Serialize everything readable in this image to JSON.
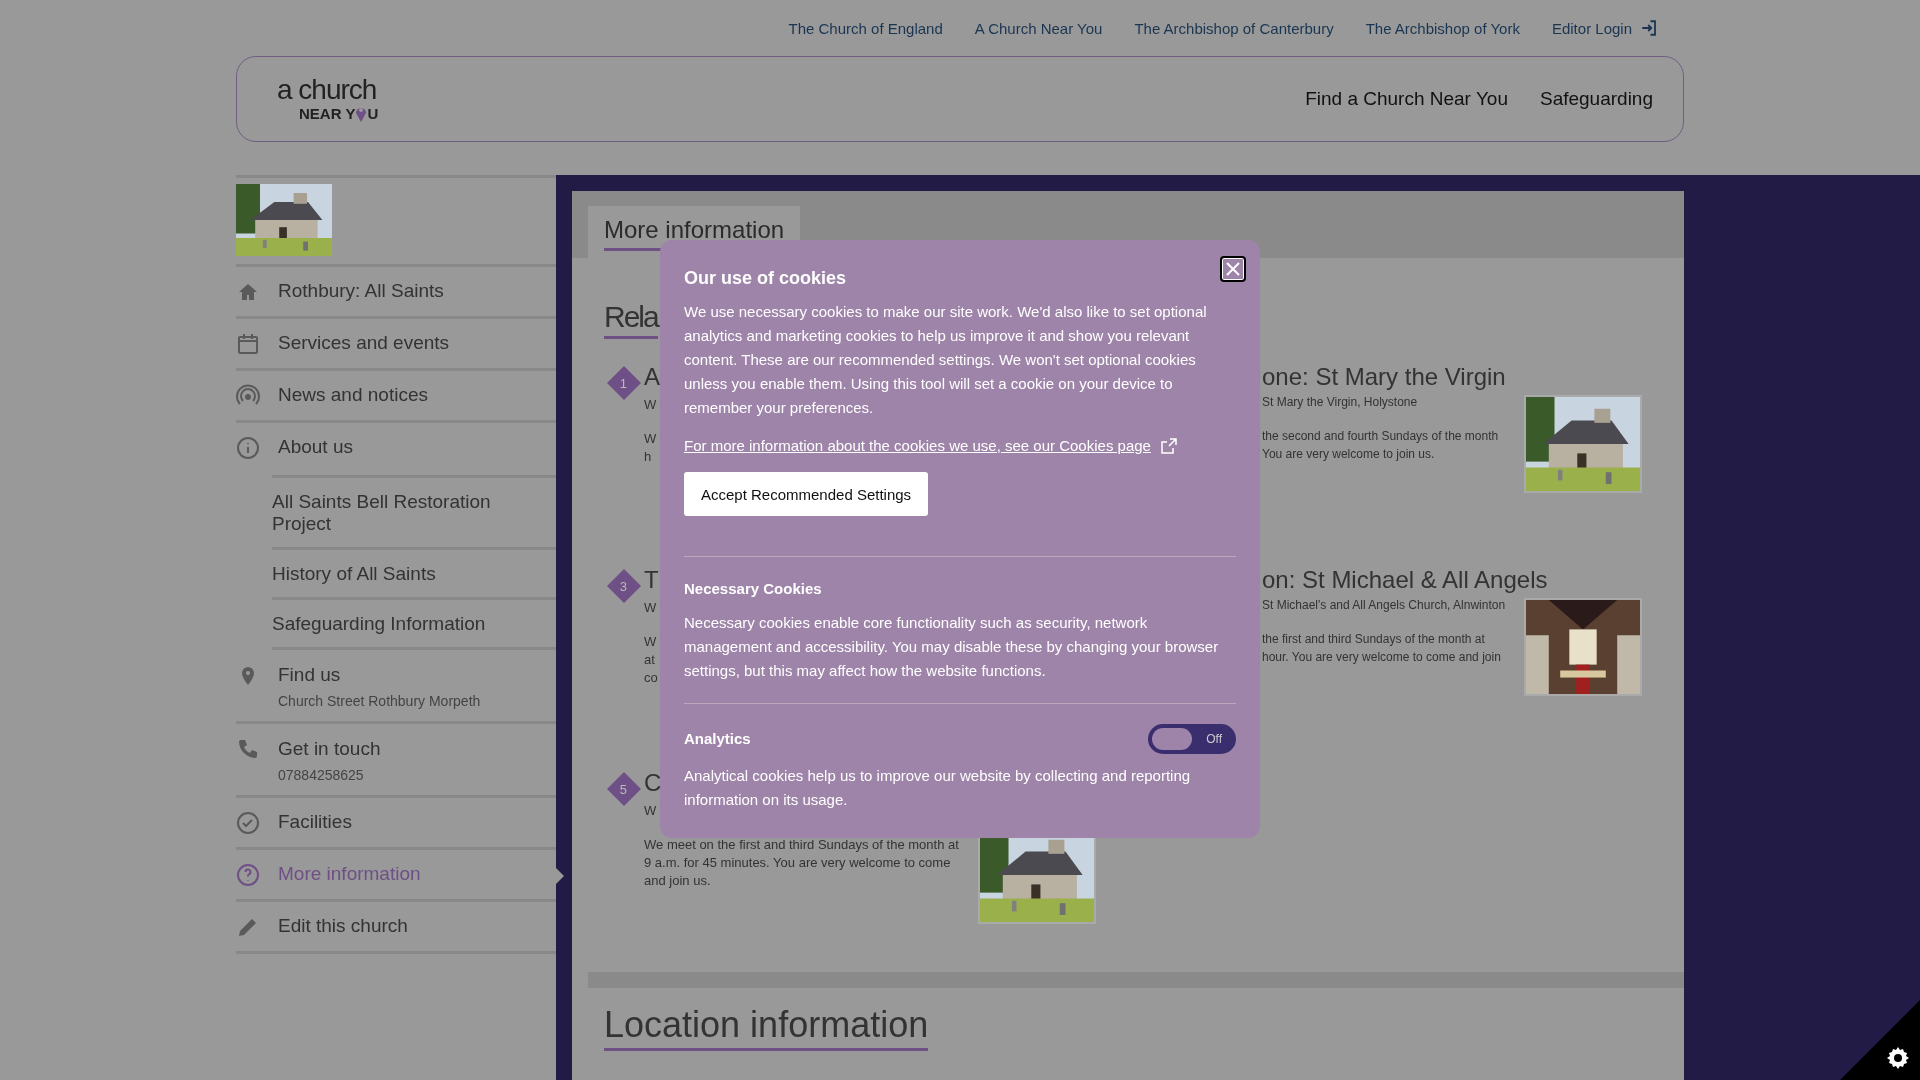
{
  "top_links": [
    "The Church of England",
    "A Church Near You",
    "The Archbishop of Canterbury",
    "The Archbishop of York",
    "Editor Login"
  ],
  "logo": {
    "line1": "a church",
    "line2_start": "NEAR Y",
    "line2_end": "U"
  },
  "header_nav": [
    "Find a Church Near You",
    "Safeguarding"
  ],
  "sidebar": {
    "items": [
      {
        "label": "Rothbury: All Saints",
        "selected": false
      },
      {
        "label": "Services and events",
        "selected": false
      },
      {
        "label": "News and notices",
        "selected": false
      },
      {
        "label": "About us",
        "selected": false,
        "expanded": true,
        "children": [
          {
            "label": "All Saints Bell Restoration Project",
            "selected": false
          },
          {
            "label": "History of All Saints",
            "selected": false
          },
          {
            "label": "Safeguarding Information",
            "selected": false
          }
        ]
      },
      {
        "label": "Find us",
        "selected": false,
        "detail": "Church Street Rothbury Morpeth"
      },
      {
        "label": "Get in touch",
        "selected": false,
        "detail": "07884258625"
      },
      {
        "label": "Facilities",
        "selected": false
      },
      {
        "label": "More information",
        "selected": true
      },
      {
        "label": "Edit this church",
        "selected": false
      }
    ]
  },
  "content": {
    "tab": "More information",
    "heading": "Rela",
    "cards": [
      {
        "kind": "left",
        "number": "1",
        "title": "A",
        "meta": "W",
        "desc": [
          "W",
          "h"
        ]
      },
      {
        "kind": "right",
        "title": "one: St Mary the Virgin",
        "meta": "St Mary the Virgin, Holystone",
        "desc": [
          "the second and fourth Sundays of the month",
          "You are very welcome to join us."
        ],
        "image": {
          "kind": "picture"
        }
      },
      {
        "kind": "left",
        "number": "3",
        "title": "T",
        "meta": "W",
        "desc": [
          "W",
          "at",
          "co"
        ]
      },
      {
        "kind": "right",
        "title": "on: St Michael & All Angels",
        "meta": "St Michael's and All Angels Church, Alnwinton",
        "desc": [
          "the first and third Sundays of the month at",
          "hour. You are very welcome to come and join"
        ],
        "image": {
          "kind": "picture"
        }
      },
      {
        "kind": "left",
        "number": "5",
        "title": "C",
        "meta": "W",
        "desc": [
          "We meet on the first and third Sundays of the month at 9 a.m. for 45 minutes. You are very welcome to come and join us."
        ],
        "image": {
          "kind": "picture"
        }
      }
    ],
    "section_heading": "Location information"
  },
  "cookie_dialog": {
    "title": "Our use of cookies",
    "intro": "We use necessary cookies to make our site work. We'd also like to set optional analytics and marketing cookies to help us improve it and show you relevant content. These are our recommended settings. We won't set optional cookies unless you enable them. Using this tool will set a cookie on your device to remember your preferences.",
    "link": "For more information about the cookies we use, see our Cookies page",
    "accept_button": "Accept Recommended Settings",
    "sections": [
      {
        "title": "Necessary Cookies",
        "text": "Necessary cookies enable core functionality such as security, network management and accessibility. You may disable these by changing your browser settings, but this may affect how the website functions."
      },
      {
        "title": "Analytics",
        "on": false,
        "state_label": "Off",
        "text": "Analytical cookies help us to improve our website by collecting and reporting information on its usage."
      }
    ]
  }
}
